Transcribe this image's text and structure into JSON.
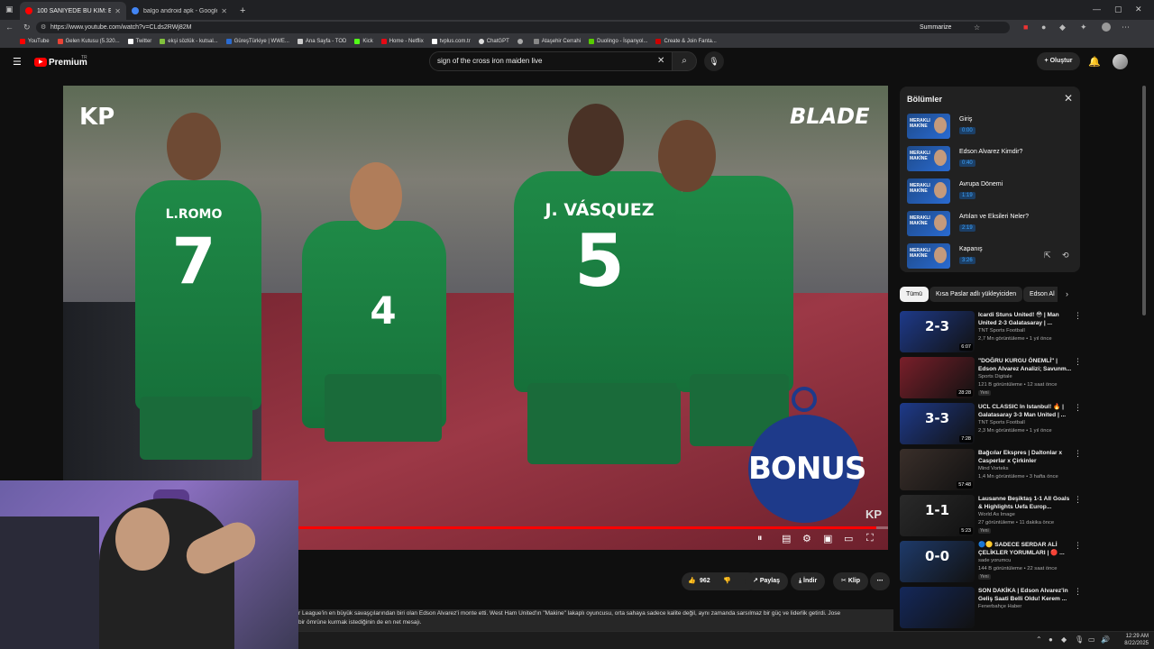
{
  "browser": {
    "tabs": [
      {
        "title": "100 SANİYEDE BU KİM: Edson Alv...",
        "active": true,
        "favicon_color": "#ff0000"
      },
      {
        "title": "balgo android apk - Google'da Ar...",
        "active": false,
        "favicon_color": "#4285f4"
      }
    ],
    "url": "https://www.youtube.com/watch?v=CLds2RWj82M",
    "summarize_label": "Summarize",
    "bookmarks": [
      "YouTube",
      "Gelen Kutusu (5.320...",
      "Twitter",
      "ekşi sözlük - kutsal...",
      "GüreşTürkiye | WWE...",
      "Ana Sayfa - TOD",
      "Kick",
      "Home - Netflix",
      "tvplus.com.tr",
      "ChatGPT",
      "",
      "Ataşehir Cerrahi",
      "Duolingo - İspanyol...",
      "Create & Join Fanta..."
    ]
  },
  "youtube": {
    "logo": "Premium",
    "logo_sup": "TR",
    "search_value": "sign of the cross iron maiden live",
    "create_label": "Oluştur"
  },
  "video": {
    "overlay_left": "KP",
    "overlay_right": "BLADE",
    "bonus_label": "BONUS",
    "overlay_kp_small": "KP",
    "progress": 0.98,
    "jerseys": [
      {
        "name": "L.ROMO",
        "number": "7"
      },
      {
        "name": "",
        "number": "4"
      },
      {
        "name": "J. VÁSQUEZ",
        "number": "5"
      }
    ]
  },
  "actions": {
    "like_count": "962",
    "share_label": "Paylaş",
    "download_label": "İndir",
    "clip_label": "Klip"
  },
  "description": {
    "line1": "r League'in en büyük savaşçılarından biri olan Edson Alvarez'i monte etti. West Ham United'ın \"Makine\" lakaplı oyuncusu, orta sahaya sadece kalite değil, aynı zamanda sarsılmaz bir güç ve liderlik getirdi. Jose",
    "line2": "bir ömrüne kurmak istediğinin de en net mesajı."
  },
  "chapters": {
    "title": "Bölümler",
    "thumb_text": "MERAKLI\nMAKİNE",
    "items": [
      {
        "name": "Giriş",
        "time": "0:00"
      },
      {
        "name": "Edson Alvarez Kimdir?",
        "time": "0:40"
      },
      {
        "name": "Avrupa Dönemi",
        "time": "1:19"
      },
      {
        "name": "Artıları ve Eksileri Neler?",
        "time": "2:19"
      },
      {
        "name": "Kapanış",
        "time": "3:26"
      }
    ]
  },
  "chips": [
    "Tümü",
    "Kısa Paslar adlı yükleyiciden",
    "Edson Al"
  ],
  "recommendations": [
    {
      "title": "Icardi Stuns United! 😳 | Man United 2-3 Galatasaray | ...",
      "channel": "TNT Sports Football",
      "meta": "2,7 Mn görüntüleme • 1 yıl önce",
      "duration": "6:07",
      "badge": "",
      "score": "2-3",
      "bg": "#1e3a8a"
    },
    {
      "title": "\"DOĞRU KURGU ÖNEMLİ\" | Edson Alvarez Analizi; Savunm...",
      "channel": "Sports Digitale",
      "meta": "121 B görüntüleme • 12 saat önce",
      "duration": "28:28",
      "badge": "Yeni",
      "score": "",
      "bg": "#7a1f2a"
    },
    {
      "title": "UCL CLASSIC In Istanbul! 🔥 | Galatasaray 3-3 Man United | ...",
      "channel": "TNT Sports Football",
      "meta": "2,3 Mn görüntüleme • 1 yıl önce",
      "duration": "7:28",
      "badge": "",
      "score": "3-3",
      "bg": "#1e3a8a"
    },
    {
      "title": "Bağcılar Ekspres | Daltonlar x Casperlar x Çirkinler",
      "channel": "Mind Vorteks",
      "meta": "1,4 Mn görüntüleme • 3 hafta önce",
      "duration": "57:48",
      "badge": "",
      "score": "",
      "bg": "#3a2f2a"
    },
    {
      "title": "Lausanne Beşiktaş 1-1 All Goals & Highlights Uefa Europ...",
      "channel": "World As Image",
      "meta": "27 görüntüleme • 11 dakika önce",
      "duration": "5:23",
      "badge": "Yeni",
      "score": "1-1",
      "bg": "#2a2a2a"
    },
    {
      "title": "🔵🟡 SADECE SERDAR ALİ ÇELİKLER YORUMLARI | 🔴 ...",
      "channel": "sade yorumcu",
      "meta": "144 B görüntüleme • 22 saat önce",
      "duration": "",
      "badge": "Yeni",
      "score": "0-0",
      "bg": "#1e3a6a"
    },
    {
      "title": "SON DAKİKA | Edson Alvarez'in Geliş Saati Belli Oldu! Kerem ...",
      "channel": "Fenerbahçe Haber",
      "meta": "",
      "duration": "",
      "badge": "",
      "score": "",
      "bg": "#14285a"
    }
  ],
  "taskbar": {
    "time": "12:29 AM",
    "date": "8/22/2025"
  }
}
